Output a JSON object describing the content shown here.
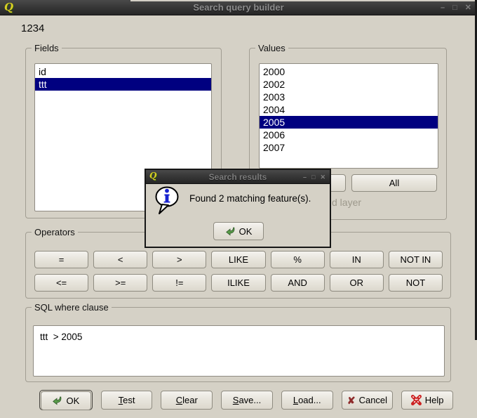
{
  "window": {
    "title": "Search query builder",
    "controls": {
      "minimize": "–",
      "maximize": "□",
      "close": "✕"
    }
  },
  "icons": {
    "qgis_logo": "Q",
    "cancel_x": "✘"
  },
  "top_label": "1234",
  "fields": {
    "label": "Fields",
    "items": [
      "id",
      "ttt"
    ],
    "selected_index": 1
  },
  "values": {
    "label": "Values",
    "items": [
      "2000",
      "2002",
      "2003",
      "2004",
      "2005",
      "2006",
      "2007"
    ],
    "selected_index": 4,
    "all_button": "All",
    "partial_label": "d layer"
  },
  "operators": {
    "label": "Operators",
    "buttons": [
      "=",
      "<",
      ">",
      "LIKE",
      "%",
      "IN",
      "NOT IN",
      "<=",
      ">=",
      "!=",
      "ILIKE",
      "AND",
      "OR",
      "NOT"
    ]
  },
  "sql": {
    "label": "SQL where clause",
    "value": "ttt  > 2005"
  },
  "footer": {
    "ok": "OK",
    "test": "Test",
    "clear": "Clear",
    "save": "Save...",
    "load": "Load...",
    "cancel": "Cancel",
    "help": "Help"
  },
  "dialog": {
    "title": "Search results",
    "message": "Found 2 matching feature(s).",
    "ok": "OK"
  },
  "colors": {
    "background": "#d5d1c6",
    "selection": "#000080",
    "titlebar_dark": "#2e2e2e",
    "accent_green": "#5a9e4a",
    "cancel_red": "#8e2b2b",
    "help_red": "#cc2222",
    "disabled_text": "#9d998c"
  }
}
